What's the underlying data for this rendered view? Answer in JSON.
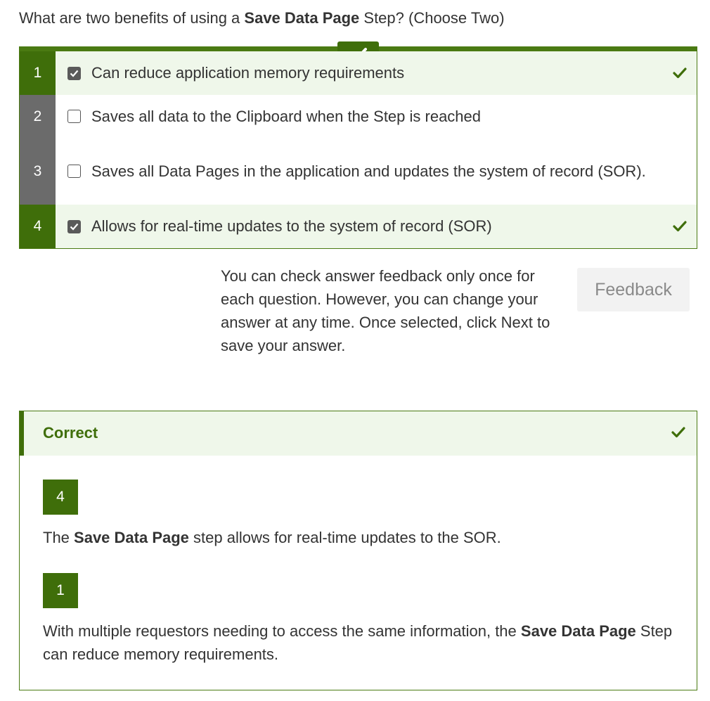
{
  "question": {
    "prefix": "What are two benefits of using a ",
    "bold": "Save Data Page",
    "suffix": " Step? (Choose Two)"
  },
  "options": [
    {
      "number": "1",
      "text": "Can reduce application memory requirements",
      "checked": true,
      "correct": true
    },
    {
      "number": "2",
      "text": "Saves all data to the Clipboard when the Step is reached",
      "checked": false,
      "correct": false
    },
    {
      "number": "3",
      "text": "Saves all Data Pages in the application and updates the system of record (SOR).",
      "checked": false,
      "correct": false
    },
    {
      "number": "4",
      "text": "Allows for real-time updates to the system of record (SOR)",
      "checked": true,
      "correct": true
    }
  ],
  "info_text": "You can check answer feedback only once for each question. However, you can change your answer at any time. Once selected, click Next to save your answer.",
  "feedback_button": "Feedback",
  "result": {
    "title": "Correct",
    "items": [
      {
        "number": "4",
        "prefix": "The ",
        "bold": "Save Data Page",
        "suffix": " step allows for real-time updates to the SOR."
      },
      {
        "number": "1",
        "prefix": "With multiple requestors needing to access the same information, the ",
        "bold": "Save Data Page",
        "suffix": " Step can reduce memory requirements."
      }
    ]
  },
  "colors": {
    "accent_green": "#3f6e0a",
    "correct_bg": "#eff7ea",
    "neutral_gray": "#6b6b6b"
  },
  "icons": {
    "top_badge": "checkmark-icon",
    "correct_marker": "checkmark-icon"
  }
}
